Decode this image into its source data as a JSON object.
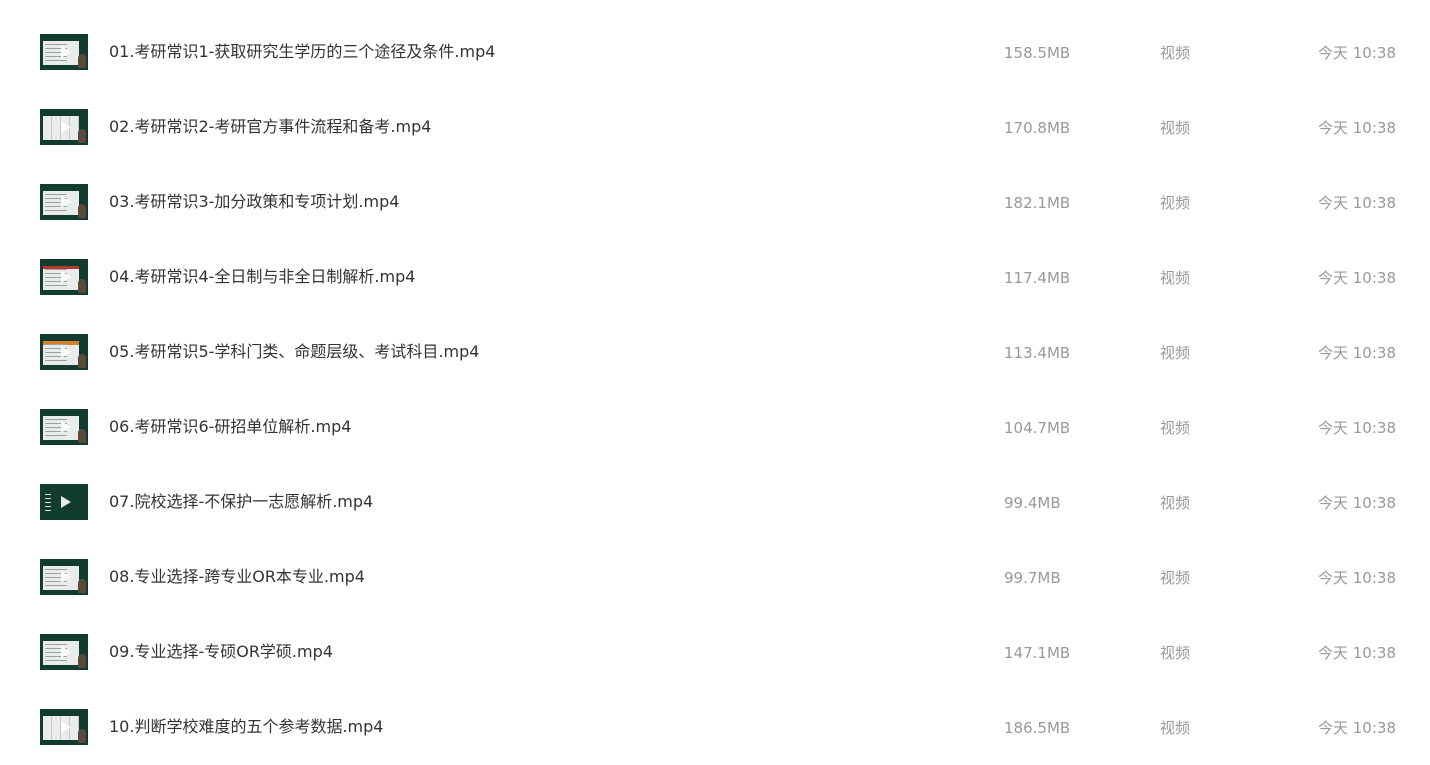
{
  "files": [
    {
      "name": "01.考研常识1-获取研究生学历的三个途径及条件.mp4",
      "size": "158.5MB",
      "type": "视频",
      "date": "今天 10:38",
      "thumbnail_icon": "video-thumbnail"
    },
    {
      "name": "02.考研常识2-考研官方事件流程和备考.mp4",
      "size": "170.8MB",
      "type": "视频",
      "date": "今天 10:38",
      "thumbnail_icon": "video-thumbnail"
    },
    {
      "name": "03.考研常识3-加分政策和专项计划.mp4",
      "size": "182.1MB",
      "type": "视频",
      "date": "今天 10:38",
      "thumbnail_icon": "video-thumbnail"
    },
    {
      "name": "04.考研常识4-全日制与非全日制解析.mp4",
      "size": "117.4MB",
      "type": "视频",
      "date": "今天 10:38",
      "thumbnail_icon": "video-thumbnail"
    },
    {
      "name": "05.考研常识5-学科门类、命题层级、考试科目.mp4",
      "size": "113.4MB",
      "type": "视频",
      "date": "今天 10:38",
      "thumbnail_icon": "video-thumbnail"
    },
    {
      "name": "06.考研常识6-研招单位解析.mp4",
      "size": "104.7MB",
      "type": "视频",
      "date": "今天 10:38",
      "thumbnail_icon": "video-thumbnail"
    },
    {
      "name": "07.院校选择-不保护一志愿解析.mp4",
      "size": "99.4MB",
      "type": "视频",
      "date": "今天 10:38",
      "thumbnail_icon": "video-thumbnail"
    },
    {
      "name": "08.专业选择-跨专业OR本专业.mp4",
      "size": "99.7MB",
      "type": "视频",
      "date": "今天 10:38",
      "thumbnail_icon": "video-thumbnail"
    },
    {
      "name": "09.专业选择-专硕OR学硕.mp4",
      "size": "147.1MB",
      "type": "视频",
      "date": "今天 10:38",
      "thumbnail_icon": "video-thumbnail"
    },
    {
      "name": "10.判断学校难度的五个参考数据.mp4",
      "size": "186.5MB",
      "type": "视频",
      "date": "今天 10:38",
      "thumbnail_icon": "video-thumbnail"
    }
  ],
  "colors": {
    "name_text": "#333333",
    "meta_text": "#999999",
    "thumbnail_bg": "#123c30"
  }
}
